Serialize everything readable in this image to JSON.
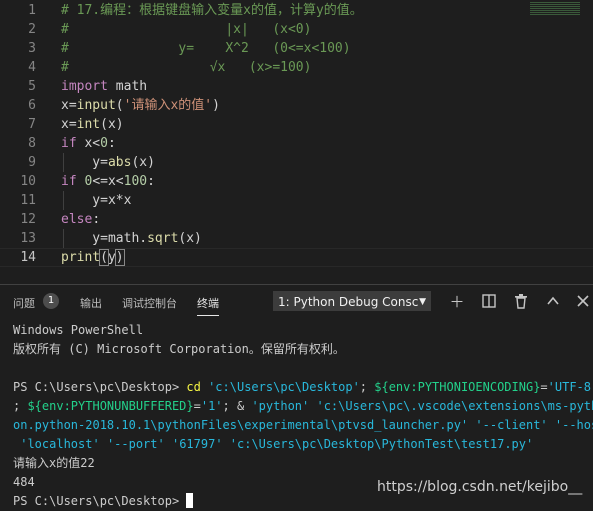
{
  "editor": {
    "lines": [
      {
        "n": "1",
        "tokens": [
          {
            "t": "# 17.编程：根据键盘输入变量x的值，计算y的值。",
            "c": "c-com"
          }
        ]
      },
      {
        "n": "2",
        "tokens": [
          {
            "t": "#                    |x|   (x<0)",
            "c": "c-com"
          }
        ]
      },
      {
        "n": "3",
        "tokens": [
          {
            "t": "#              y=    X^2   (0<=x<100)",
            "c": "c-com"
          }
        ]
      },
      {
        "n": "4",
        "tokens": [
          {
            "t": "#                  √x   (x>=100)",
            "c": "c-com"
          }
        ]
      },
      {
        "n": "5",
        "tokens": [
          {
            "t": "import",
            "c": "c-kw"
          },
          {
            "t": " math",
            "c": "c-op"
          }
        ]
      },
      {
        "n": "6",
        "tokens": [
          {
            "t": "x",
            "c": "c-op"
          },
          {
            "t": "=",
            "c": "c-op"
          },
          {
            "t": "input",
            "c": "c-fn"
          },
          {
            "t": "(",
            "c": "c-op"
          },
          {
            "t": "'请输入x的值'",
            "c": "c-str"
          },
          {
            "t": ")",
            "c": "c-op"
          }
        ]
      },
      {
        "n": "7",
        "tokens": [
          {
            "t": "x",
            "c": "c-op"
          },
          {
            "t": "=",
            "c": "c-op"
          },
          {
            "t": "int",
            "c": "c-fn"
          },
          {
            "t": "(x)",
            "c": "c-op"
          }
        ]
      },
      {
        "n": "8",
        "tokens": [
          {
            "t": "if",
            "c": "c-kw"
          },
          {
            "t": " x<",
            "c": "c-op"
          },
          {
            "t": "0",
            "c": "c-num"
          },
          {
            "t": ":",
            "c": "c-op"
          }
        ]
      },
      {
        "n": "9",
        "tokens": [
          {
            "t": "    y=",
            "c": "c-op"
          },
          {
            "t": "abs",
            "c": "c-fn"
          },
          {
            "t": "(x)",
            "c": "c-op"
          }
        ]
      },
      {
        "n": "10",
        "tokens": [
          {
            "t": "if",
            "c": "c-kw"
          },
          {
            "t": " ",
            "c": "c-op"
          },
          {
            "t": "0",
            "c": "c-num"
          },
          {
            "t": "<=x<",
            "c": "c-op"
          },
          {
            "t": "100",
            "c": "c-num"
          },
          {
            "t": ":",
            "c": "c-op"
          }
        ]
      },
      {
        "n": "11",
        "tokens": [
          {
            "t": "    y=x*x",
            "c": "c-op"
          }
        ]
      },
      {
        "n": "12",
        "tokens": [
          {
            "t": "else",
            "c": "c-kw"
          },
          {
            "t": ":",
            "c": "c-op"
          }
        ]
      },
      {
        "n": "13",
        "tokens": [
          {
            "t": "    y=math.",
            "c": "c-op"
          },
          {
            "t": "sqrt",
            "c": "c-fn"
          },
          {
            "t": "(x)",
            "c": "c-op"
          }
        ]
      },
      {
        "n": "14",
        "tokens": [
          {
            "t": "print",
            "c": "c-fn"
          },
          {
            "t": "(",
            "c": "c-op bracket"
          },
          {
            "t": "y",
            "c": "c-op"
          },
          {
            "t": ")",
            "c": "c-op bracket"
          }
        ]
      }
    ]
  },
  "panel": {
    "tabs": {
      "problems": "问题",
      "problems_count": "1",
      "output": "输出",
      "debug_console": "调试控制台",
      "terminal": "终端"
    },
    "terminal_select": "1: Python Debug Consc",
    "icons": {
      "add": "plus-icon",
      "split": "split-icon",
      "trash": "trash-icon",
      "maximize": "chevron-up-icon",
      "close": "close-icon"
    }
  },
  "terminal": {
    "lines": [
      [
        {
          "t": "Windows PowerShell",
          "c": ""
        }
      ],
      [
        {
          "t": "版权所有 (C) Microsoft Corporation。保留所有权利。",
          "c": ""
        }
      ],
      [
        {
          "t": "",
          "c": ""
        }
      ],
      [
        {
          "t": "PS C:\\Users\\pc\\Desktop> ",
          "c": ""
        },
        {
          "t": "cd",
          "c": "t-yel"
        },
        {
          "t": " ",
          "c": ""
        },
        {
          "t": "'c:\\Users\\pc\\Desktop'",
          "c": "t-tok"
        },
        {
          "t": "; ",
          "c": ""
        },
        {
          "t": "${env:PYTHONIOENCODING}",
          "c": "t-str"
        },
        {
          "t": "=",
          "c": ""
        },
        {
          "t": "'UTF-8'",
          "c": "t-tok"
        }
      ],
      [
        {
          "t": "; ",
          "c": ""
        },
        {
          "t": "${env:PYTHONUNBUFFERED}",
          "c": "t-str"
        },
        {
          "t": "=",
          "c": ""
        },
        {
          "t": "'1'",
          "c": "t-tok"
        },
        {
          "t": "; & ",
          "c": ""
        },
        {
          "t": "'python'",
          "c": "t-tok"
        },
        {
          "t": " ",
          "c": ""
        },
        {
          "t": "'c:\\Users\\pc\\.vscode\\extensions\\ms-pyth",
          "c": "t-tok"
        }
      ],
      [
        {
          "t": "on.python-2018.10.1\\pythonFiles\\experimental\\ptvsd_launcher.py'",
          "c": "t-tok"
        },
        {
          "t": " ",
          "c": ""
        },
        {
          "t": "'--client'",
          "c": "t-tok"
        },
        {
          "t": " ",
          "c": ""
        },
        {
          "t": "'--host",
          "c": "t-tok"
        }
      ],
      [
        {
          "t": " 'localhost'",
          "c": "t-tok"
        },
        {
          "t": " ",
          "c": ""
        },
        {
          "t": "'--port'",
          "c": "t-tok"
        },
        {
          "t": " ",
          "c": ""
        },
        {
          "t": "'61797'",
          "c": "t-tok"
        },
        {
          "t": " ",
          "c": ""
        },
        {
          "t": "'c:\\Users\\pc\\Desktop\\PythonTest\\test17.py'",
          "c": "t-tok"
        }
      ],
      [
        {
          "t": "请输入x的值22",
          "c": ""
        }
      ],
      [
        {
          "t": "484",
          "c": ""
        }
      ],
      [
        {
          "t": "PS C:\\Users\\pc\\Desktop> ",
          "c": ""
        }
      ]
    ]
  },
  "watermark": "https://blog.csdn.net/kejibo__"
}
